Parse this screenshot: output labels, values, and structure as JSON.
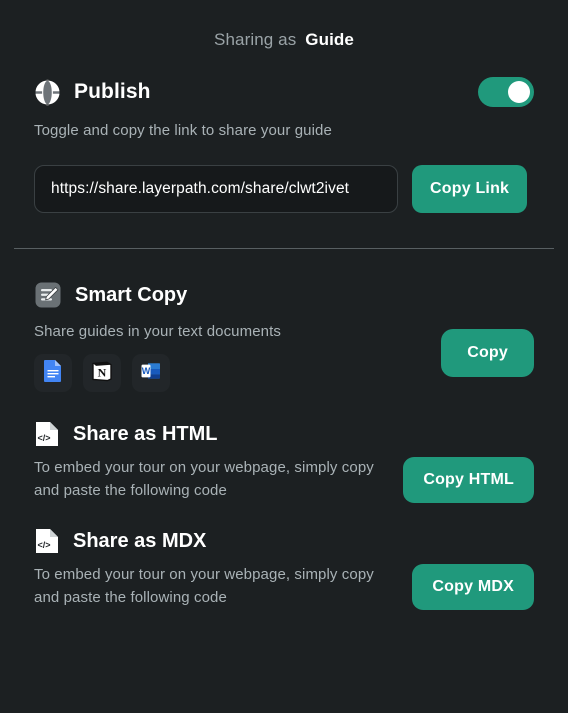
{
  "header": {
    "prefix": "Sharing as",
    "title": "Guide"
  },
  "publish": {
    "icon": "globe-icon",
    "title": "Publish",
    "subtitle": "Toggle and copy the link to share your guide",
    "toggle_state": "on",
    "link_value": "https://share.layerpath.com/share/clwt2ivet",
    "link_placeholder": "https://share.layerpath.com/share/",
    "copy_link_label": "Copy Link"
  },
  "smart_copy": {
    "icon": "note-edit-icon",
    "title": "Smart Copy",
    "description": "Share guides in your text documents",
    "copy_label": "Copy",
    "apps": [
      {
        "name": "google-docs",
        "label": "Google Docs"
      },
      {
        "name": "notion",
        "label": "Notion"
      },
      {
        "name": "microsoft-word",
        "label": "Microsoft Word"
      }
    ]
  },
  "share_html": {
    "icon": "code-file-icon",
    "title": "Share as HTML",
    "description": "To embed your tour on your webpage, simply copy and paste the following code",
    "button_label": "Copy HTML"
  },
  "share_mdx": {
    "icon": "code-file-icon",
    "title": "Share as MDX",
    "description": "To embed your tour on your webpage, simply copy and paste the following code",
    "button_label": "Copy MDX"
  },
  "colors": {
    "background": "#1c2022",
    "accent": "#20997c",
    "text_primary": "#ffffff",
    "text_muted": "#a9b2b6",
    "divider": "#585f62",
    "input_bg": "#16191b",
    "input_border": "#3a4043"
  }
}
